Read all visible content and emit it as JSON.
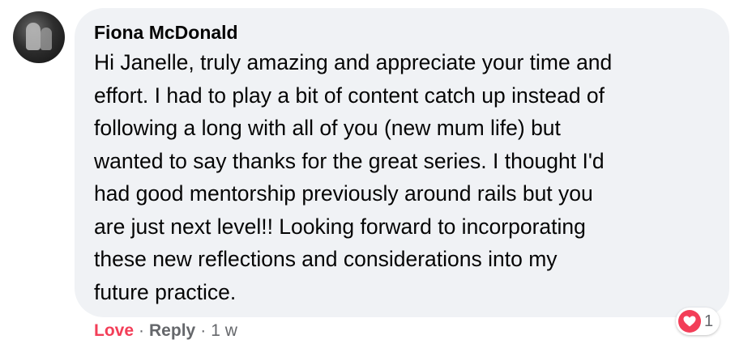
{
  "comment": {
    "author": "Fiona McDonald",
    "lines": [
      "Hi Janelle, truly amazing and appreciate your time and",
      "effort. I had to play a bit of content catch up instead of",
      "following a long with all of you (new mum life) but",
      "wanted to say thanks for the great series. I thought I'd",
      "had good mentorship previously around rails but you",
      "are just next level!! Looking forward to incorporating",
      "these new reflections and considerations into my",
      "future practice."
    ],
    "avatar_icon": "profile-photo",
    "reaction_icon": "heart-icon",
    "reaction_count": "1"
  },
  "actions": {
    "love_label": "Love",
    "separator": "·",
    "reply_label": "Reply",
    "timestamp": "1 w"
  },
  "colors": {
    "bubble": "#f0f2f5",
    "love": "#f33e58",
    "meta": "#65676b",
    "text": "#050505"
  }
}
